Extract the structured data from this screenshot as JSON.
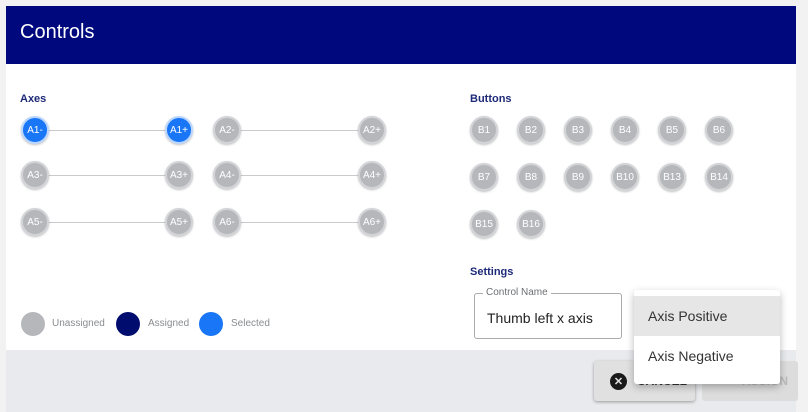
{
  "header": {
    "title": "Controls"
  },
  "axes": {
    "label": "Axes",
    "rows": [
      {
        "nodes": [
          "A1-",
          "A1+",
          "A2-",
          "A2+"
        ],
        "selected": [
          "A1-",
          "A1+"
        ]
      },
      {
        "nodes": [
          "A3-",
          "A3+",
          "A4-",
          "A4+"
        ],
        "selected": []
      },
      {
        "nodes": [
          "A5-",
          "A5+",
          "A6-",
          "A6+"
        ],
        "selected": []
      }
    ]
  },
  "buttons": {
    "label": "Buttons",
    "rows": [
      [
        "B1",
        "B2",
        "B3",
        "B4",
        "B5",
        "B6"
      ],
      [
        "B7",
        "B8",
        "B9",
        "B10",
        "B13",
        "B14"
      ],
      [
        "B15",
        "B16"
      ]
    ]
  },
  "legend": {
    "unassigned": {
      "label": "Unassigned",
      "color": "#b5b7bb"
    },
    "assigned": {
      "label": "Assigned",
      "color": "#000c6e"
    },
    "selected": {
      "label": "Selected",
      "color": "#1976f6"
    }
  },
  "settings": {
    "label": "Settings",
    "control_name": {
      "label": "Control Name",
      "value": "Thumb left x axis"
    }
  },
  "dropdown_menu": {
    "options": [
      "Axis Positive",
      "Axis Negative"
    ],
    "highlighted": "Axis Positive"
  },
  "actions": {
    "cancel_label": "CANCEL",
    "assign_label": "ASSIGN",
    "cancel_icon": "close-circle-icon"
  },
  "colors": {
    "header": "#00087e",
    "accent": "#1976f6"
  }
}
